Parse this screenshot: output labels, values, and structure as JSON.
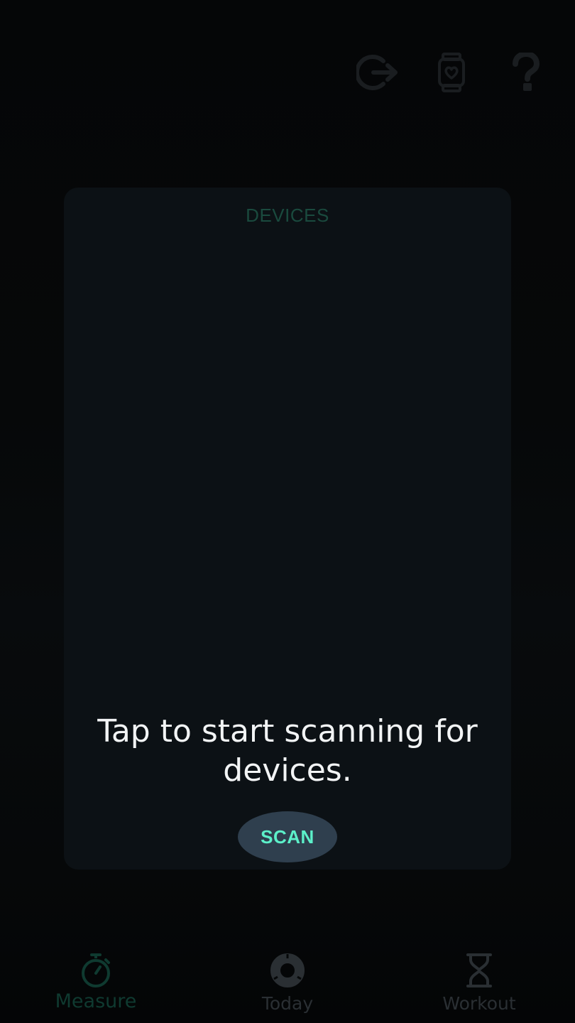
{
  "header": {
    "icons": [
      "logout-icon",
      "watch-heart-icon",
      "help-icon"
    ]
  },
  "devices_card": {
    "title": "DEVICES",
    "message": "Tap to start scanning for devices.",
    "scan_label": "SCAN"
  },
  "bottom_nav": {
    "items": [
      {
        "label": "Measure",
        "icon": "stopwatch-icon",
        "active": true
      },
      {
        "label": "Today",
        "icon": "donut-chart-icon",
        "active": false
      },
      {
        "label": "Workout",
        "icon": "hourglass-icon",
        "active": false
      }
    ]
  },
  "colors": {
    "background": "#050607",
    "card": "#0c1115",
    "title_text": "#1a4a3e",
    "message_text": "#f2f4f5",
    "scan_button_bg": "#2f3f4e",
    "scan_button_text": "#5cf0c9",
    "nav_active": "#0f3a30",
    "nav_inactive": "#2a2f33",
    "header_icons": "#1a1d20"
  }
}
